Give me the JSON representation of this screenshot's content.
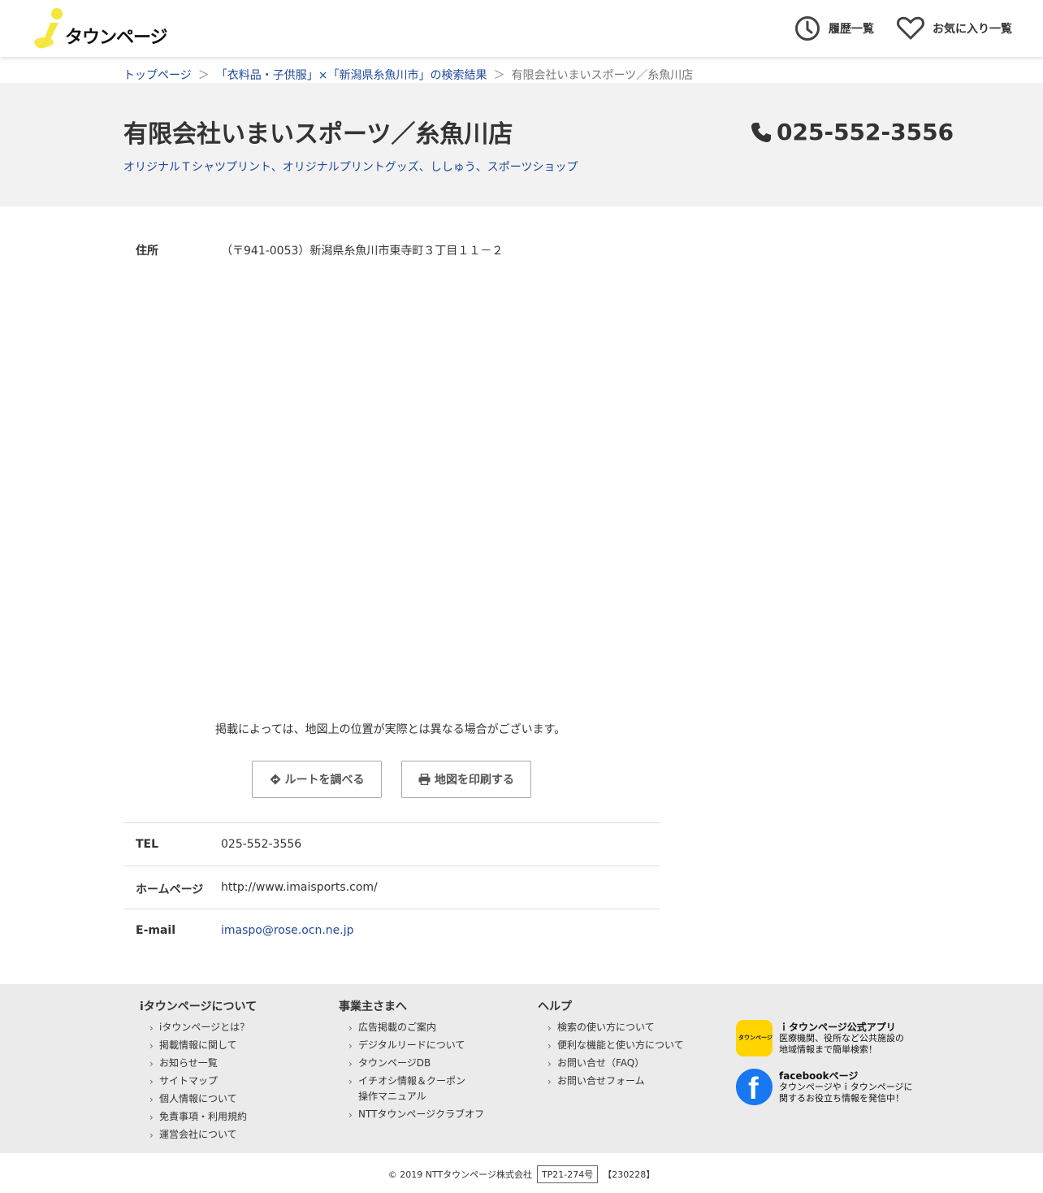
{
  "header": {
    "logo_text": "タウンページ",
    "history_label": "履歴一覧",
    "favorites_label": "お気に入り一覧"
  },
  "breadcrumb": {
    "home": "トップページ",
    "sep": "＞",
    "results": "「衣料品・子供服」×「新潟県糸魚川市」の検索結果",
    "current": "有限会社いまいスポーツ／糸魚川店"
  },
  "shop": {
    "name": "有限会社いまいスポーツ／糸魚川店",
    "categories": "オリジナルＴシャツプリント、オリジナルプリントグッズ、ししゅう、スポーツショップ",
    "phone": "025-552-3556"
  },
  "info": {
    "address_label": "住所",
    "address_value": "（〒941-0053）新潟県糸魚川市東寺町３丁目１１－２",
    "map_note": "掲載によっては、地図上の位置が実際とは異なる場合がございます。",
    "route_button": "ルートを調べる",
    "print_button": "地図を印刷する",
    "tel_label": "TEL",
    "tel_value": "025-552-3556",
    "homepage_label": "ホームページ",
    "homepage_value": "http://www.imaisports.com/",
    "email_label": "E-mail",
    "email_value": "imaspo@rose.ocn.ne.jp"
  },
  "footer": {
    "col1": {
      "title": "iタウンページについて",
      "items": [
        "iタウンページとは？",
        "掲載情報に関して",
        "お知らせ一覧",
        "サイトマップ",
        "個人情報について",
        "免責事項・利用規約",
        "運営会社について"
      ]
    },
    "col2": {
      "title": "事業主さまへ",
      "items": [
        "広告掲載のご案内",
        "デジタルリードについて",
        "タウンページDB",
        "イチオシ情報＆クーポン",
        "NTTタウンページクラブオフ"
      ],
      "item3_line2": "操作マニュアル"
    },
    "col3": {
      "title": "ヘルプ",
      "items": [
        "検索の使い方について",
        "便利な機能と使い方について",
        "お問い合せ（FAQ）",
        "お問い合せフォーム"
      ]
    },
    "app_promo": {
      "icon_text": "タウンページ",
      "title": "ｉタウンページ公式アプリ",
      "line1": "医療機関、役所など公共施設の",
      "line2": "地域情報まで簡単検索！"
    },
    "fb_promo": {
      "title": "facebookページ",
      "line1": "タウンページやｉタウンページに",
      "line2": "関するお役立ち情報を発信中！"
    }
  },
  "copyright": {
    "text": "© 2019 NTTタウンページ株式会社",
    "code": "TP21-274号",
    "date": "【230228】"
  },
  "colors": {
    "link": "#1f4a99",
    "band": "#f2f2f2",
    "footer_bg": "#ebebeb",
    "logo_yellow": "#f5e63a",
    "facebook": "#1877f2"
  }
}
